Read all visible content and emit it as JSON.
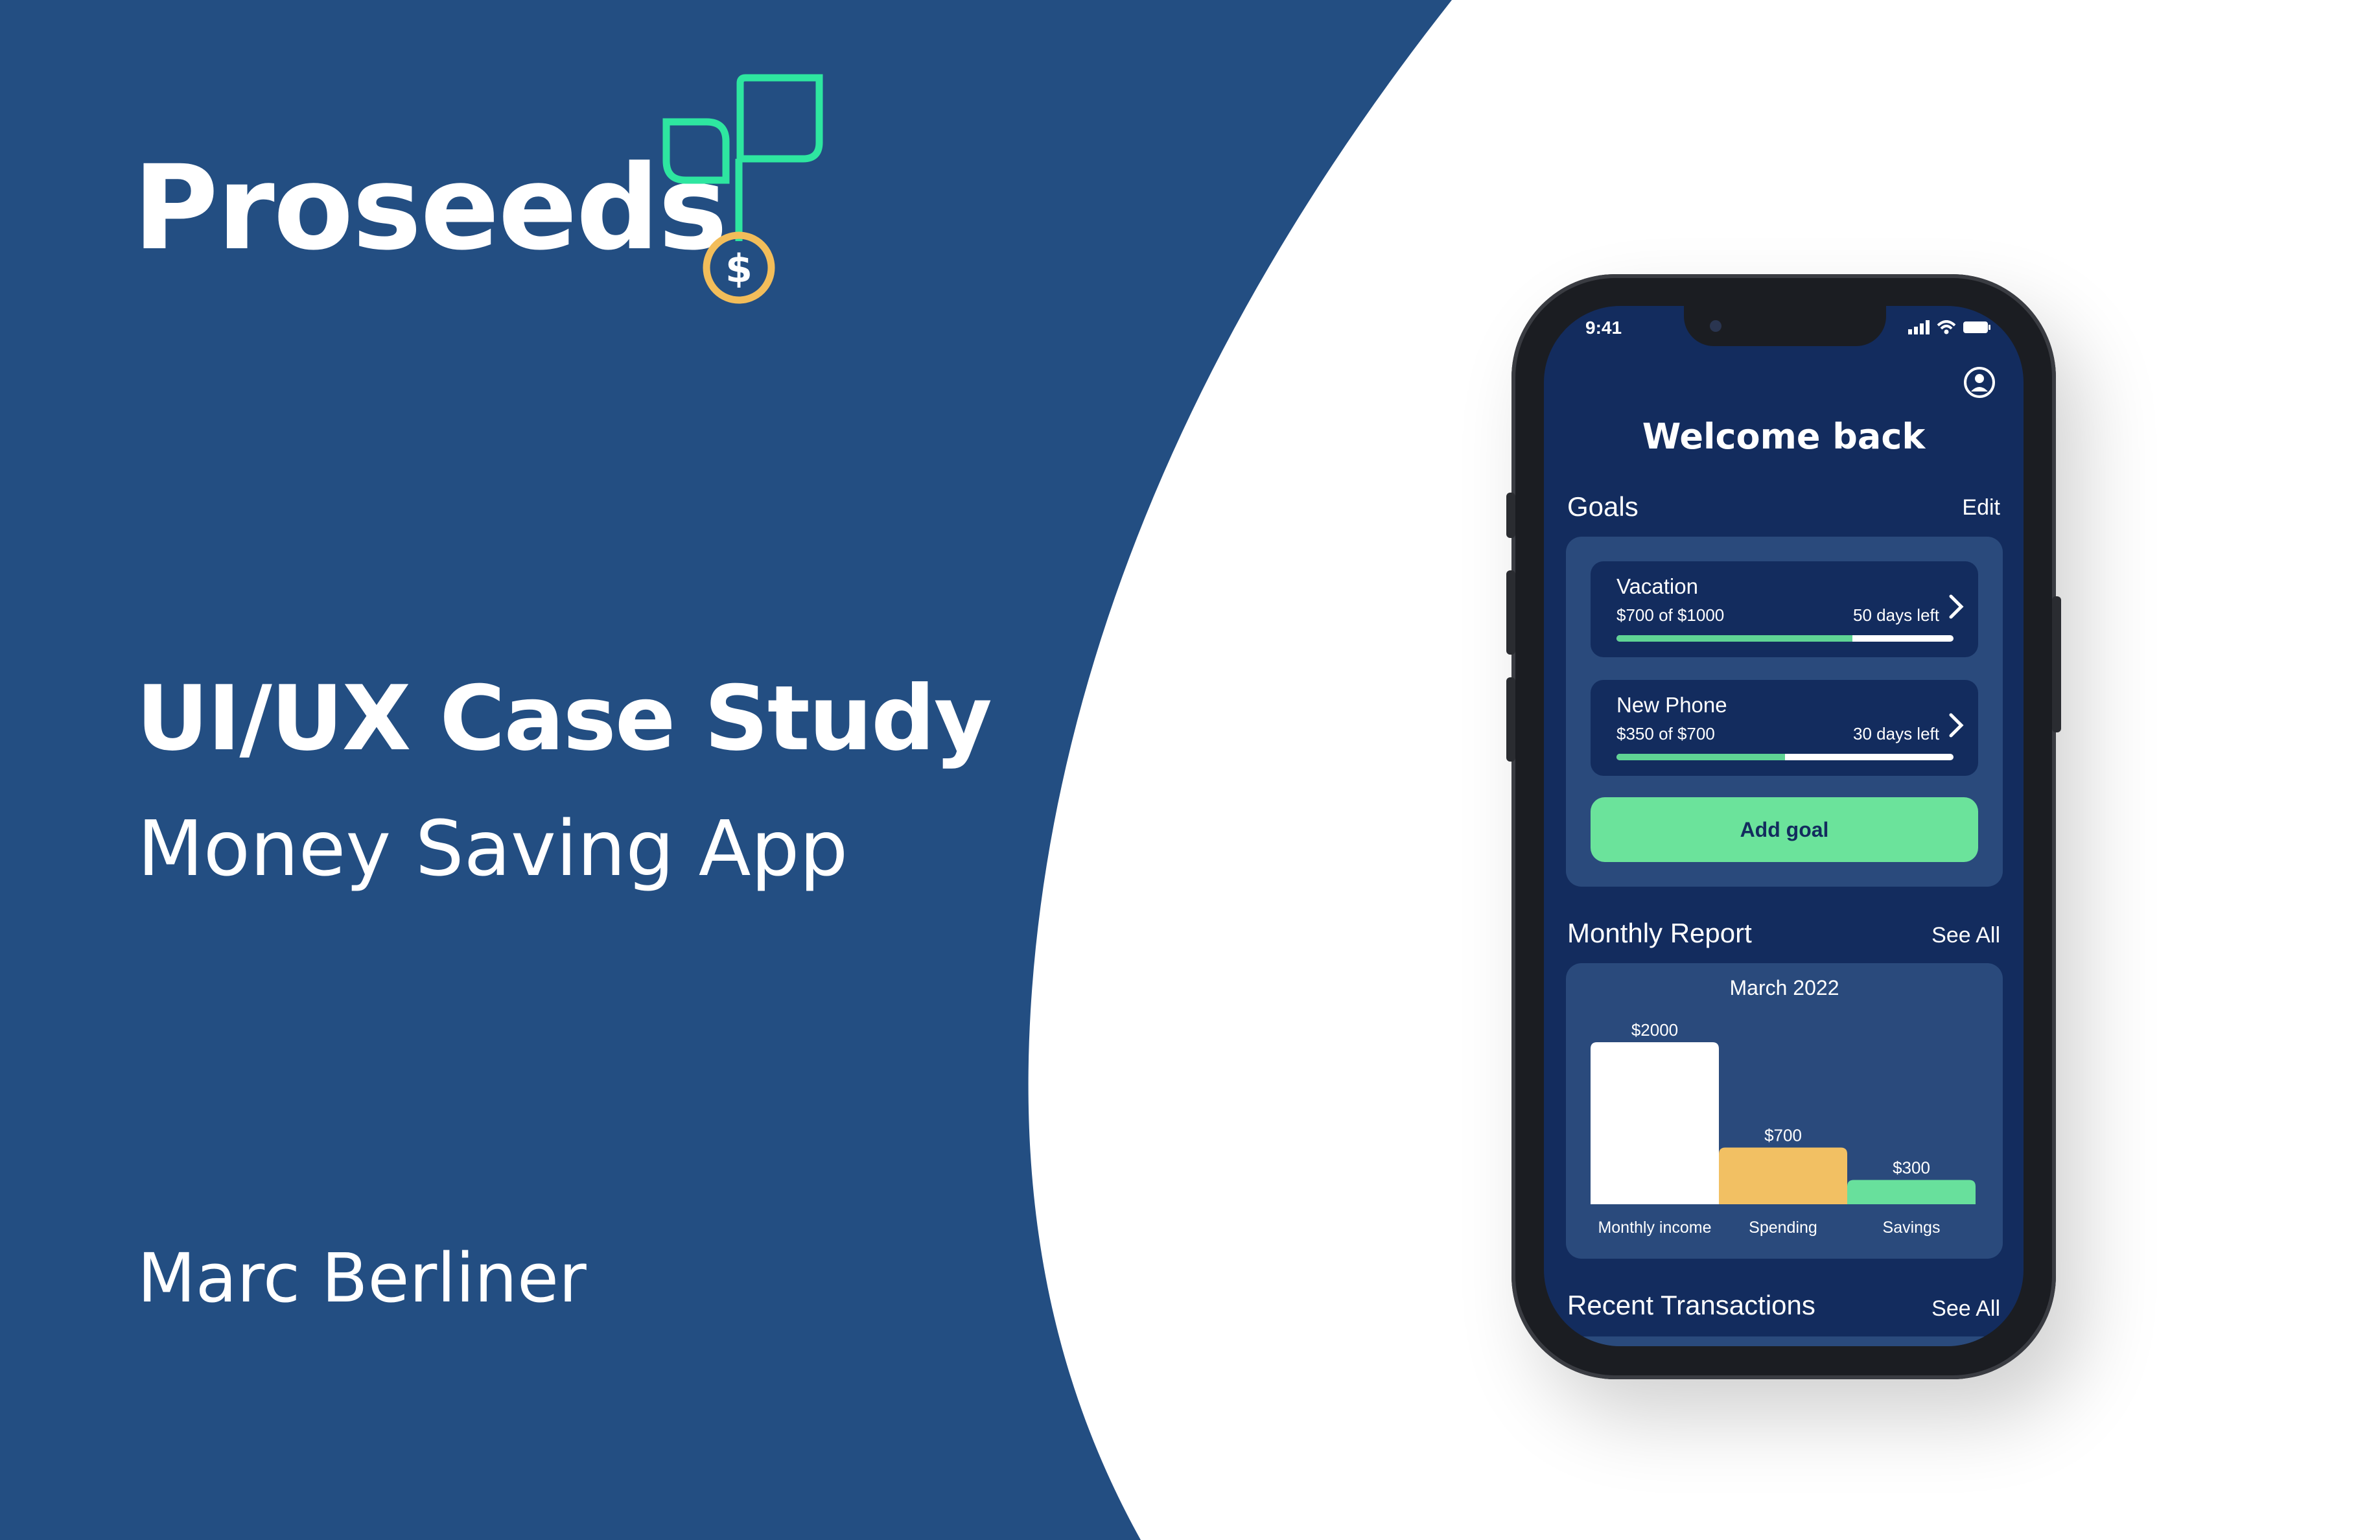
{
  "cover": {
    "brand_name": "Proseeds",
    "headline": "UI/UX Case Study",
    "subheading": "Money Saving App",
    "author": "Marc Berliner",
    "colors": {
      "background_blue": "#234e82",
      "logo_green": "#2ee6a0",
      "logo_coin": "#f2bd5a"
    }
  },
  "phone": {
    "status_time": "9:41",
    "welcome": "Welcome back",
    "goals": {
      "title": "Goals",
      "edit_label": "Edit",
      "items": [
        {
          "name": "Vacation",
          "amount": "$700 of $1000",
          "days_left": "50 days left",
          "progress": 0.7
        },
        {
          "name": "New Phone",
          "amount": "$350 of $700",
          "days_left": "30 days left",
          "progress": 0.5
        }
      ],
      "add_goal_label": "Add goal"
    },
    "monthly_report": {
      "title": "Monthly Report",
      "see_all_label": "See All",
      "month": "March 2022"
    },
    "recent_transactions": {
      "title": "Recent Transactions",
      "see_all_label": "See All"
    }
  },
  "chart_data": {
    "type": "bar",
    "title": "March 2022",
    "categories": [
      "Monthly income",
      "Spending",
      "Savings"
    ],
    "values": [
      2000,
      700,
      300
    ],
    "value_labels": [
      "$2000",
      "$700",
      "$300"
    ],
    "colors": [
      "#ffffff",
      "#f2c063",
      "#68e09c"
    ],
    "ylim": [
      0,
      2000
    ],
    "grid": false
  }
}
